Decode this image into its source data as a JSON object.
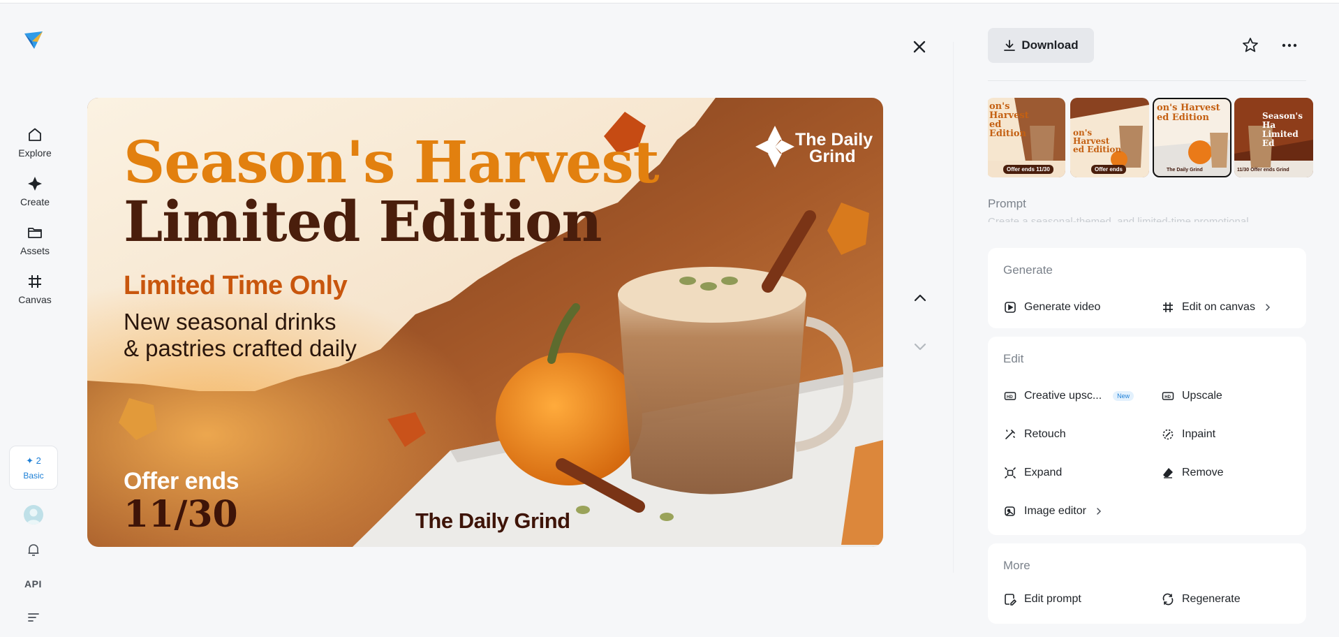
{
  "nav": {
    "items": [
      {
        "label": "Explore",
        "icon": "home-icon"
      },
      {
        "label": "Create",
        "icon": "sparkle-icon"
      },
      {
        "label": "Assets",
        "icon": "folder-icon"
      },
      {
        "label": "Canvas",
        "icon": "frame-icon"
      }
    ],
    "credits": {
      "count": "2",
      "plan": "Basic"
    },
    "api_label": "API"
  },
  "image": {
    "headline_1": "Season's Harvest",
    "headline_2": "Limited Edition",
    "subhead": "Limited Time Only",
    "body_1": "New seasonal drinks",
    "body_2": "& pastries crafted daily",
    "offer_label": "Offer ends",
    "offer_date": "11/30",
    "brand_1": "The Daily",
    "brand_2": "Grind",
    "footer_brand": "The Daily Grind"
  },
  "toolbar": {
    "download_label": "Download"
  },
  "thumbnails": [
    {
      "caption": "Offer ends 11/30",
      "title": "on's Harvest ed Edition",
      "active": false
    },
    {
      "caption": "Offer ends",
      "title": "on's Harvest ed Edition",
      "active": false
    },
    {
      "caption": "The Daily Grind",
      "title": "on's Harvest ed Edition",
      "active": true
    },
    {
      "caption": "11/30 Offer ends Grind",
      "title": "Season's Ha Limited Ed",
      "active": false
    }
  ],
  "prompt": {
    "label": "Prompt",
    "text": "Create a seasonal-themed, and limited-time promotional"
  },
  "generate": {
    "title": "Generate",
    "generate_video": "Generate video",
    "edit_on_canvas": "Edit on canvas"
  },
  "edit": {
    "title": "Edit",
    "creative_upscale": "Creative upsc...",
    "new_badge": "New",
    "upscale": "Upscale",
    "retouch": "Retouch",
    "inpaint": "Inpaint",
    "expand": "Expand",
    "remove": "Remove",
    "image_editor": "Image editor"
  },
  "more": {
    "title": "More",
    "edit_prompt": "Edit prompt",
    "regenerate": "Regenerate"
  },
  "colors": {
    "accent_blue": "#1d7fd6",
    "headline_orange": "#d9720c",
    "headline_brown": "#4a1e0c",
    "subhead_orange": "#c8560d"
  }
}
